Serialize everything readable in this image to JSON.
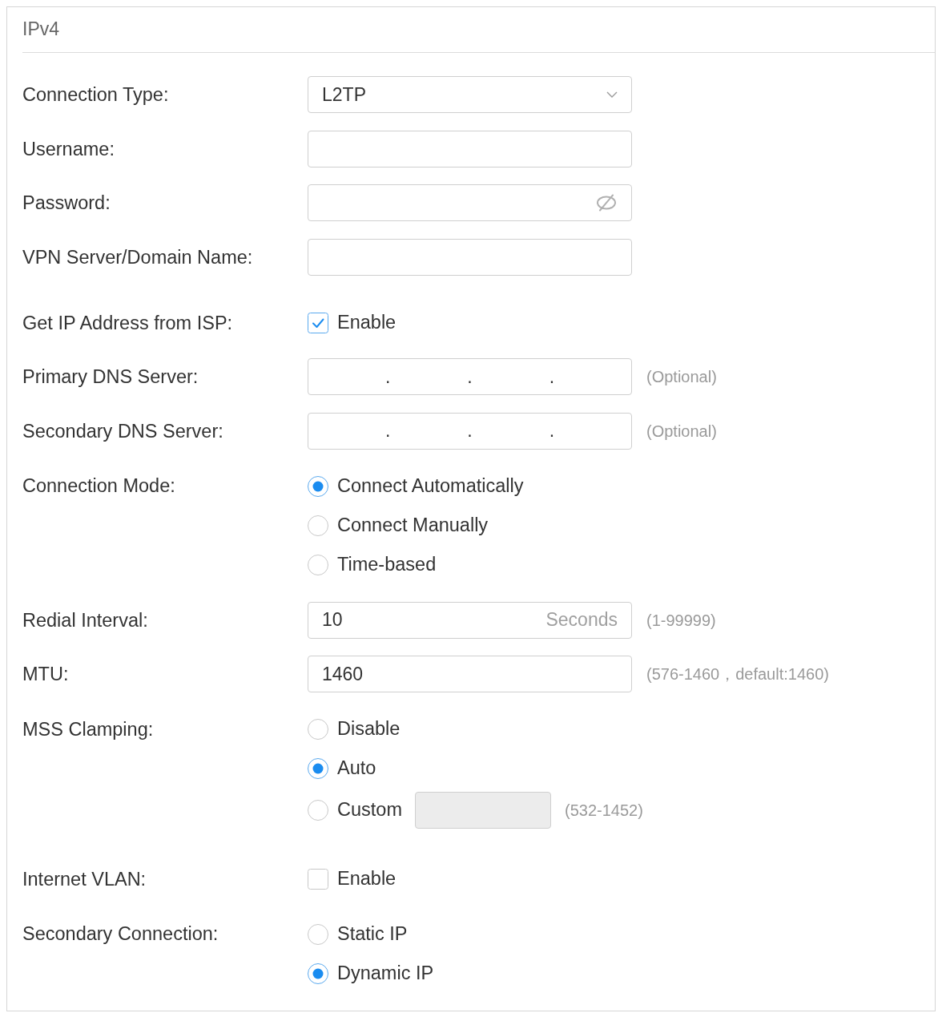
{
  "panel": {
    "title": "IPv4"
  },
  "fields": [
    {
      "kind": "select",
      "label": "Connection Type:",
      "value": "L2TP"
    },
    {
      "kind": "text",
      "label": "Username:"
    },
    {
      "kind": "password",
      "label": "Password:"
    },
    {
      "kind": "text",
      "label": "VPN Server/Domain Name:"
    },
    {
      "kind": "checkbox",
      "label": "Get IP Address from ISP:",
      "option": "Enable",
      "checked": true
    },
    {
      "kind": "ip",
      "label": "Primary DNS Server:",
      "separators": [
        ".",
        ".",
        "."
      ],
      "hint": "(Optional)"
    },
    {
      "kind": "ip",
      "label": "Secondary DNS Server:",
      "separators": [
        ".",
        ".",
        "."
      ],
      "hint": "(Optional)"
    },
    {
      "kind": "radio",
      "label": "Connection Mode:",
      "options": [
        {
          "label": "Connect Automatically",
          "selected": true
        },
        {
          "label": "Connect Manually",
          "selected": false
        },
        {
          "label": "Time-based",
          "selected": false
        }
      ]
    },
    {
      "kind": "unit",
      "label": "Redial Interval:",
      "value": "10",
      "unit": "Seconds",
      "hint": "(1-99999)"
    },
    {
      "kind": "text",
      "label": "MTU:",
      "value": "1460",
      "hint": "(576-1460，default:1460)"
    },
    {
      "kind": "radio",
      "label": "MSS Clamping:",
      "options": [
        {
          "label": "Disable",
          "selected": false
        },
        {
          "label": "Auto",
          "selected": true
        },
        {
          "label": "Custom",
          "selected": false,
          "field": {
            "disabled": true
          },
          "hint": "(532-1452)"
        }
      ]
    },
    {
      "kind": "checkbox",
      "label": "Internet VLAN:",
      "option": "Enable",
      "checked": false
    },
    {
      "kind": "radio",
      "label": "Secondary Connection:",
      "options": [
        {
          "label": "Static IP",
          "selected": false
        },
        {
          "label": "Dynamic IP",
          "selected": true
        }
      ]
    }
  ]
}
